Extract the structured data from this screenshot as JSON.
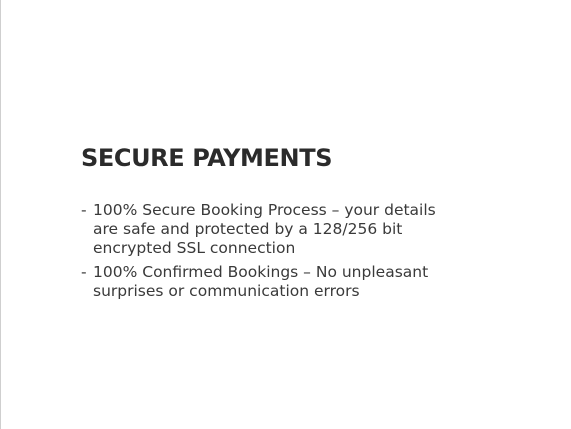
{
  "section": {
    "title": "SECURE PAYMENTS",
    "bullet": "-",
    "features": [
      {
        "text": "100% Secure Booking Process – your details are safe and protected by a 128/256 bit encrypted SSL connection"
      },
      {
        "text": "100% Confirmed Bookings – No unpleasant surprises or communication errors"
      }
    ]
  }
}
